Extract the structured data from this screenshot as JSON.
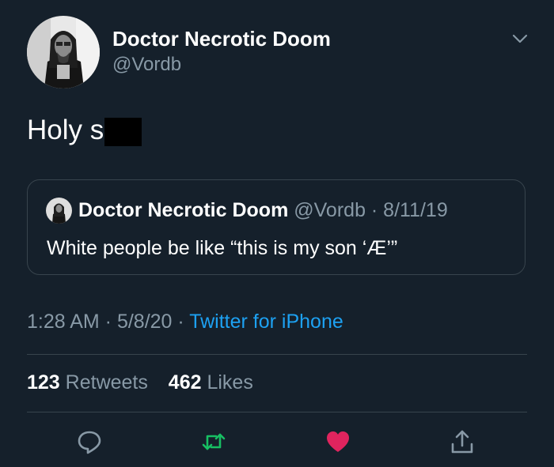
{
  "author": {
    "display_name": "Doctor Necrotic Doom",
    "handle": "@Vordb"
  },
  "tweet": {
    "text": "Holy s"
  },
  "quoted_tweet": {
    "display_name": "Doctor Necrotic Doom",
    "meta": " @Vordb · 8/11/19",
    "text": "White people be like “this is my son ‘Æ’”"
  },
  "meta": {
    "time_date": "1:28 AM · 5/8/20 · ",
    "source": "Twitter for iPhone"
  },
  "stats": {
    "retweets_count": "123",
    "retweets_label": " Retweets",
    "likes_count": "462",
    "likes_label": " Likes"
  },
  "actions": {
    "reply_icon": "reply-icon",
    "retweet_icon": "retweet-icon",
    "like_icon": "heart-icon",
    "share_icon": "share-icon"
  },
  "colors": {
    "background": "#15202b",
    "secondary_text": "#8899a6",
    "link": "#1da1f2",
    "retweet": "#17bf63",
    "like": "#e0245e",
    "border": "#38444d"
  }
}
